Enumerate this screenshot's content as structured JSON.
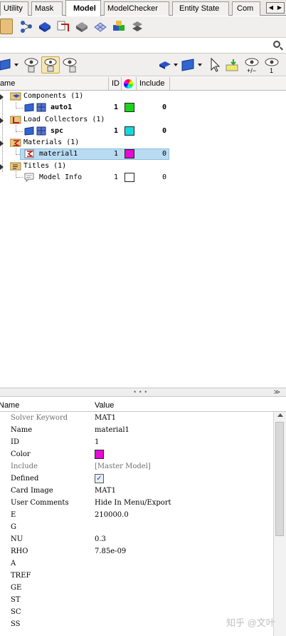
{
  "tabs": [
    "Utility",
    "Mask",
    "Model",
    "ModelChecker",
    "Entity State",
    "Com"
  ],
  "active_tab": "Model",
  "tab_nav": {
    "prev": "◀",
    "next": "▶"
  },
  "search": {
    "value": "",
    "placeholder": ""
  },
  "tree": {
    "columns": [
      "Name",
      "ID",
      "Include"
    ],
    "rows": [
      {
        "label": "Components (1)",
        "id": "",
        "include": "",
        "color": ""
      },
      {
        "label": "auto1",
        "id": "1",
        "include": "0",
        "color": "#19d419"
      },
      {
        "label": "Load Collectors (1)",
        "id": "",
        "include": "",
        "color": ""
      },
      {
        "label": "spc",
        "id": "1",
        "include": "0",
        "color": "#14d8e0"
      },
      {
        "label": "Materials (1)",
        "id": "",
        "include": "",
        "color": ""
      },
      {
        "label": "material1",
        "id": "1",
        "include": "0",
        "color": "#e60ad6"
      },
      {
        "label": "Titles (1)",
        "id": "",
        "include": "",
        "color": ""
      },
      {
        "label": "Model Info",
        "id": "1",
        "include": "0",
        "color": "#ffffff"
      }
    ]
  },
  "properties": {
    "columns": [
      "Name",
      "Value"
    ],
    "rows": [
      {
        "name": "Solver Keyword",
        "value": "MAT1"
      },
      {
        "name": "Name",
        "value": "material1"
      },
      {
        "name": "ID",
        "value": "1"
      },
      {
        "name": "Color",
        "value": "",
        "color": "#e60ad6"
      },
      {
        "name": "Include",
        "value": "[Master Model]"
      },
      {
        "name": "Defined",
        "value": "✓"
      },
      {
        "name": "Card Image",
        "value": "MAT1"
      },
      {
        "name": "User Comments",
        "value": "Hide In Menu/Export"
      },
      {
        "name": "E",
        "value": "210000.0"
      },
      {
        "name": "G",
        "value": ""
      },
      {
        "name": "NU",
        "value": "0.3"
      },
      {
        "name": "RHO",
        "value": "7.85e-09"
      },
      {
        "name": "A",
        "value": ""
      },
      {
        "name": "TREF",
        "value": ""
      },
      {
        "name": "GE",
        "value": ""
      },
      {
        "name": "ST",
        "value": ""
      },
      {
        "name": "SC",
        "value": ""
      },
      {
        "name": "SS",
        "value": ""
      }
    ]
  },
  "splitter": {
    "dots": "• • •",
    "chevron": "≫"
  },
  "watermark": "知乎 @文叶"
}
